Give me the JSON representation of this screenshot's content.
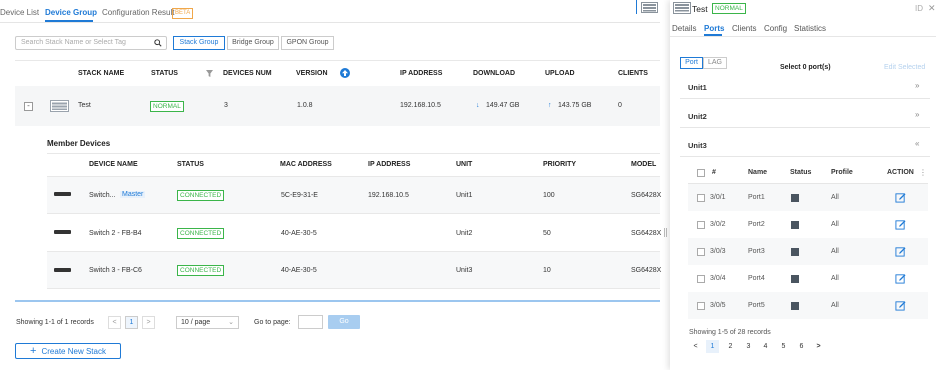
{
  "tabs": {
    "device_list": "Device List",
    "device_group": "Device Group",
    "configuration_result": "Configuration Result",
    "beta": "BETA"
  },
  "search": {
    "placeholder": "Search Stack Name or Select Tag"
  },
  "group_filters": [
    "Stack Group",
    "Bridge Group",
    "GPON Group"
  ],
  "stack_table": {
    "headers": {
      "stack_name": "STACK NAME",
      "status": "STATUS",
      "devices_num": "DEVICES NUM",
      "version": "VERSION",
      "ip_address": "IP ADDRESS",
      "download": "DOWNLOAD",
      "upload": "UPLOAD",
      "clients": "CLIENTS"
    },
    "row": {
      "collapse": "-",
      "name": "Test",
      "status": "NORMAL",
      "devices_num": "3",
      "version": "1.0.8",
      "ip_address": "192.168.10.5",
      "download": "149.47 GB",
      "upload": "143.75 GB",
      "clients": "0"
    }
  },
  "member_devices": {
    "title": "Member Devices",
    "headers": {
      "device_name": "DEVICE NAME",
      "status": "STATUS",
      "mac_address": "MAC ADDRESS",
      "ip_address": "IP ADDRESS",
      "unit": "UNIT",
      "priority": "PRIORITY",
      "model": "MODEL"
    },
    "rows": [
      {
        "name": "Switch...",
        "tag": "Master",
        "status": "CONNECTED",
        "mac": "5C-E9-31-E",
        "ip": "192.168.10.5",
        "unit": "Unit1",
        "priority": "100",
        "model": "SG6428X"
      },
      {
        "name": "Switch 2 - FB-B4",
        "tag": "",
        "status": "CONNECTED",
        "mac": "40-AE-30-5",
        "ip": "",
        "unit": "Unit2",
        "priority": "50",
        "model": "SG6428X"
      },
      {
        "name": "Switch 3 - FB-C6",
        "tag": "",
        "status": "CONNECTED",
        "mac": "40-AE-30-5",
        "ip": "",
        "unit": "Unit3",
        "priority": "10",
        "model": "SG6428X"
      }
    ]
  },
  "pagination": {
    "showing": "Showing 1-1 of 1 records",
    "prev": "<",
    "page": "1",
    "next": ">",
    "per_page": "10 / page",
    "goto_label": "Go to page:",
    "go": "Go"
  },
  "create_button": "Create New Stack",
  "panel": {
    "title": "Test",
    "status": "NORMAL",
    "top_right": "ID",
    "tabs": [
      "Details",
      "Ports",
      "Clients",
      "Config",
      "Statistics"
    ],
    "port_toggle": [
      "Port",
      "LAG"
    ],
    "select_count": "Select 0 port(s)",
    "edit_selected": "Edit Selected",
    "units": [
      "Unit1",
      "Unit2",
      "Unit3"
    ],
    "port_headers": {
      "num": "#",
      "name": "Name",
      "status": "Status",
      "profile": "Profile",
      "action": "ACTION"
    },
    "ports": [
      {
        "num": "3/0/1",
        "name": "Port1",
        "profile": "All"
      },
      {
        "num": "3/0/2",
        "name": "Port2",
        "profile": "All"
      },
      {
        "num": "3/0/3",
        "name": "Port3",
        "profile": "All"
      },
      {
        "num": "3/0/4",
        "name": "Port4",
        "profile": "All"
      },
      {
        "num": "3/0/5",
        "name": "Port5",
        "profile": "All"
      }
    ],
    "showing": "Showing 1-5 of 28 records",
    "pages": [
      "1",
      "2",
      "3",
      "4",
      "5",
      "6"
    ],
    "prev": "<",
    "next": ">"
  },
  "colors": {
    "accent": "#1f7ad6",
    "success": "#3bb54a",
    "beta": "#f0a74a"
  }
}
